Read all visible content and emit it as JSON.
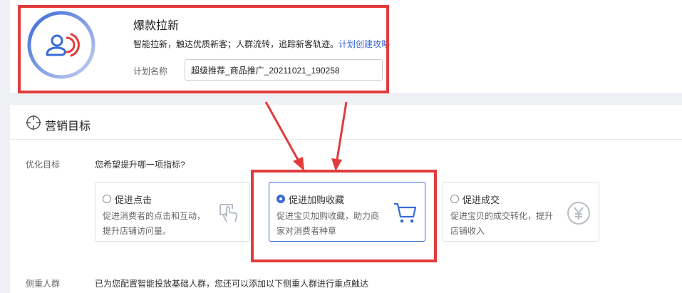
{
  "plan": {
    "title": "爆款拉新",
    "desc": "智能拉新，触达优质新客；人群流转，追踪新客轨迹。",
    "desc_link": "计划创建攻略",
    "name_label": "计划名称",
    "name_value": "超级推荐_商品推广_20211021_190258"
  },
  "section": {
    "title": "营销目标"
  },
  "goal": {
    "label": "优化目标",
    "question": "您希望提升哪一项指标?"
  },
  "options": [
    {
      "title": "促进点击",
      "desc": "促进消费者的点击和互动，提升店铺访问量。",
      "icon": "touch-click-icon",
      "selected": false
    },
    {
      "title": "促进加购收藏",
      "desc": "促进宝贝加购收藏，助力商家对消费者种草",
      "icon": "shopping-cart-icon",
      "selected": true
    },
    {
      "title": "促进成交",
      "desc": "促进宝贝的成交转化，提升店铺收入",
      "icon": "yuan-coin-icon",
      "selected": false
    }
  ],
  "crowd": {
    "label": "侧重人群",
    "text": "已为您配置智能投放基础人群，您还可以添加以下侧重人群进行重点触达"
  },
  "colors": {
    "accent": "#3a6bd6",
    "highlight": "#e23b3b",
    "ring_start": "#3a6bd6",
    "ring_end": "#c5d0f2"
  }
}
